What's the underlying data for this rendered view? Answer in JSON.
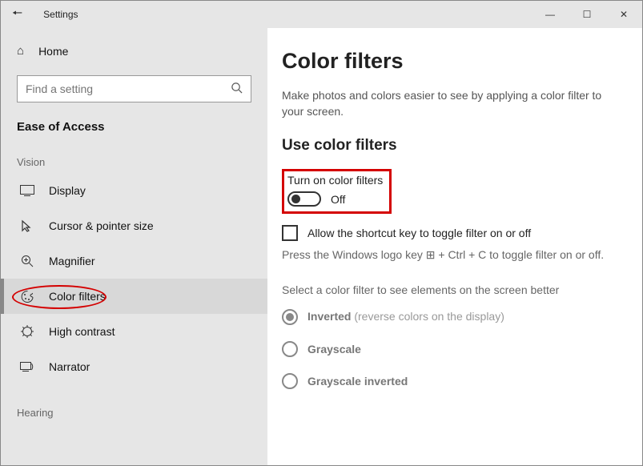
{
  "titlebar": {
    "app_title": "Settings"
  },
  "sidebar": {
    "home": "Home",
    "search_placeholder": "Find a setting",
    "section": "Ease of Access",
    "group1": "Vision",
    "items": [
      {
        "label": "Display"
      },
      {
        "label": "Cursor & pointer size"
      },
      {
        "label": "Magnifier"
      },
      {
        "label": "Color filters"
      },
      {
        "label": "High contrast"
      },
      {
        "label": "Narrator"
      }
    ],
    "group2": "Hearing"
  },
  "main": {
    "heading": "Color filters",
    "description": "Make photos and colors easier to see by applying a color filter to your screen.",
    "subheading": "Use color filters",
    "toggle_label": "Turn on color filters",
    "toggle_state": "Off",
    "checkbox_label": "Allow the shortcut key to toggle filter on or off",
    "hint_pre": "Press the Windows logo key ",
    "hint_post": " + Ctrl + C to toggle filter on or off.",
    "select_desc": "Select a color filter to see elements on the screen better",
    "radios": [
      {
        "label": "Inverted",
        "sub": " (reverse colors on the display)"
      },
      {
        "label": "Grayscale",
        "sub": ""
      },
      {
        "label": "Grayscale inverted",
        "sub": ""
      }
    ]
  }
}
